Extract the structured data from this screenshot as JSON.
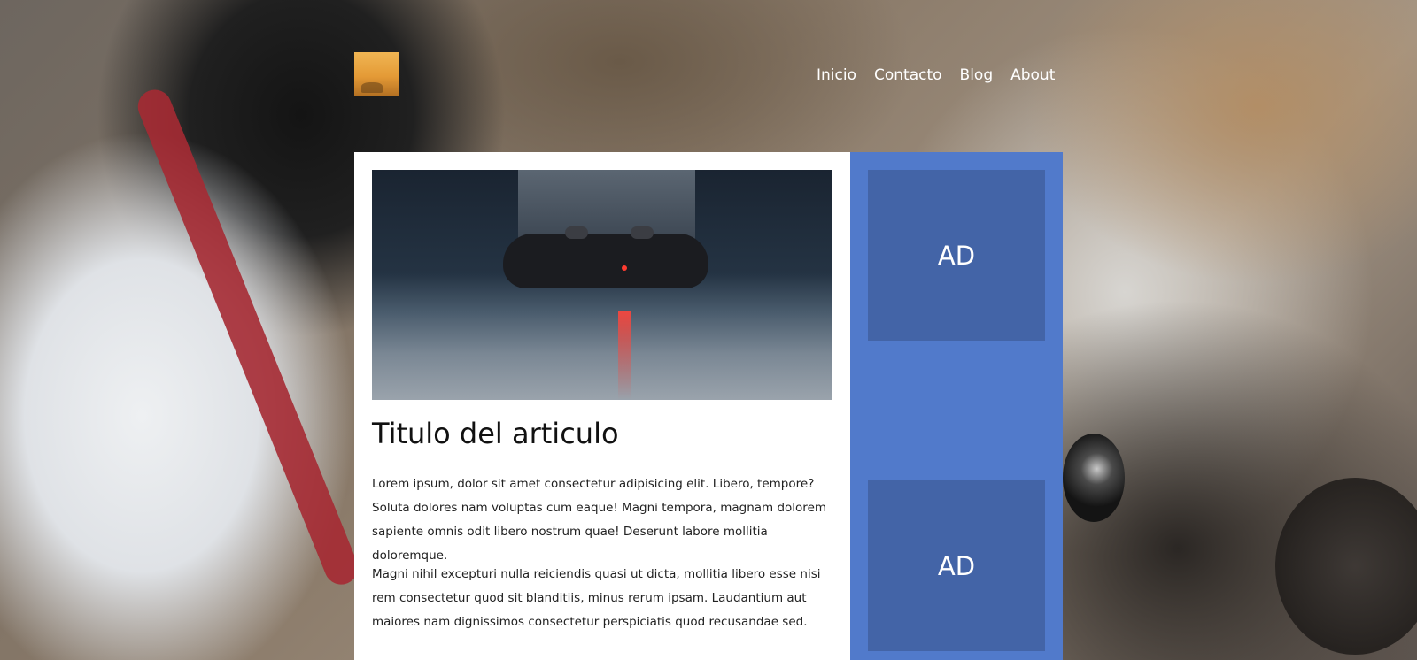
{
  "header": {
    "nav": [
      "Inicio",
      "Contacto",
      "Blog",
      "About"
    ]
  },
  "article": {
    "title": "Titulo del articulo",
    "paragraphs": [
      "Lorem ipsum, dolor sit amet consectetur adipisicing elit. Libero, tempore? Soluta dolores nam voluptas cum eaque! Magni tempora, magnam dolorem sapiente omnis odit libero nostrum quae! Deserunt labore mollitia doloremque.",
      "Magni nihil excepturi nulla reiciendis quasi ut dicta, mollitia libero esse nisi rem consectetur quod sit blanditiis, minus rerum ipsam. Laudantium aut maiores nam dignissimos consectetur perspiciatis quod recusandae sed."
    ]
  },
  "sidebar": {
    "ads": [
      "AD",
      "AD"
    ]
  },
  "colors": {
    "sidebar_bg": "#517acb",
    "ad_bg": "#4364a7",
    "card_bg": "#ffffff",
    "nav_text": "#ffffff"
  },
  "icons": {
    "logo": "logo-image"
  }
}
